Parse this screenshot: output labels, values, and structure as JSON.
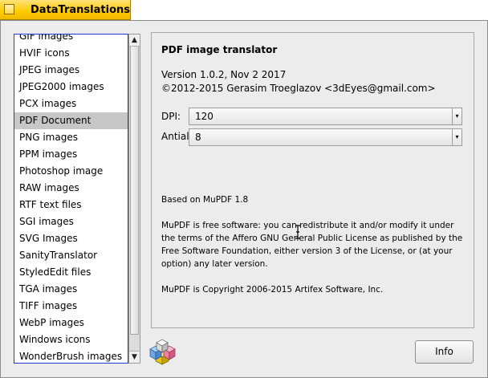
{
  "window": {
    "title": "DataTranslations"
  },
  "translators": {
    "items": [
      "GIF images",
      "HVIF icons",
      "JPEG images",
      "JPEG2000 images",
      "PCX images",
      "PDF Document",
      "PNG images",
      "PPM images",
      "Photoshop image",
      "RAW images",
      "RTF text files",
      "SGI images",
      "SVG Images",
      "SanityTranslator",
      "StyledEdit files",
      "TGA images",
      "TIFF images",
      "WebP images",
      "Windows icons",
      "WonderBrush images"
    ],
    "selected": "PDF Document"
  },
  "panel": {
    "heading": "PDF image translator",
    "version": "Version 1.0.2, Nov  2 2017",
    "copyright": "©2012-2015 Gerasim Troeglazov <3dEyes@gmail.com>",
    "dpi_label": "DPI:",
    "dpi_value": "120",
    "aa_label": "Antialiasing bits:",
    "aa_value": "8",
    "based_on": "Based on MuPDF 1.8",
    "license": "MuPDF is free software: you can redistribute it and/or modify it under the terms of the Affero GNU General Public License as published by the Free Software Foundation, either version 3 of the License, or (at your option) any later version.",
    "mupdf_copyright": "MuPDF is Copyright 2006-2015 Artifex Software, Inc."
  },
  "buttons": {
    "info": "Info"
  },
  "icons": {
    "close": "close-box-icon",
    "app": "cubes-icon",
    "scroll_up": "arrow-up-icon",
    "scroll_down": "arrow-down-icon",
    "dropdown": "chevron-down-icon"
  },
  "colors": {
    "tab": "#ffcb00",
    "list_border": "#1d3bd6",
    "selection": "#c7c7c7"
  }
}
